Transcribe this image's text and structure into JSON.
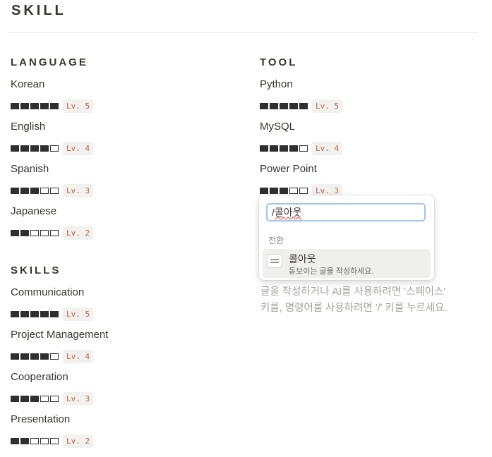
{
  "page": {
    "title": "SKILL"
  },
  "sections": {
    "language": {
      "heading": "LANGUAGE",
      "items": [
        {
          "name": "Korean",
          "level": 5,
          "level_label": "Lv. 5"
        },
        {
          "name": "English",
          "level": 4,
          "level_label": "Lv. 4"
        },
        {
          "name": "Spanish",
          "level": 3,
          "level_label": "Lv. 3"
        },
        {
          "name": "Japanese",
          "level": 2,
          "level_label": "Lv. 2"
        }
      ]
    },
    "tool": {
      "heading": "TOOL",
      "items": [
        {
          "name": "Python",
          "level": 5,
          "level_label": "Lv. 5"
        },
        {
          "name": "MySQL",
          "level": 4,
          "level_label": "Lv. 4"
        },
        {
          "name": "Power Point",
          "level": 3,
          "level_label": "Lv. 3"
        }
      ]
    },
    "skills": {
      "heading": "SKILLS",
      "items": [
        {
          "name": "Communication",
          "level": 5,
          "level_label": "Lv. 5"
        },
        {
          "name": "Project Management",
          "level": 4,
          "level_label": "Lv. 4"
        },
        {
          "name": "Cooperation",
          "level": 3,
          "level_label": "Lv. 3"
        },
        {
          "name": "Presentation",
          "level": 2,
          "level_label": "Lv. 2"
        }
      ]
    }
  },
  "rating_max": 5,
  "colors": {
    "text": "#37352f",
    "badge_text": "#c15f3c",
    "badge_bg": "#f1f1ef",
    "input_focus": "#9fc4ef"
  },
  "command_menu": {
    "input_slash": "/",
    "input_text": "콜아웃",
    "section_label": "전환",
    "item": {
      "icon": "callout-icon",
      "title": "콜아웃",
      "description": "돋보이는 글을 작성하세요."
    }
  },
  "hint": {
    "line1": "글을 작성하거나 AI를 사용하려면 '스페이스'",
    "line2": "키를, 명령어를 사용하려면 '/' 키를 누르세요."
  }
}
